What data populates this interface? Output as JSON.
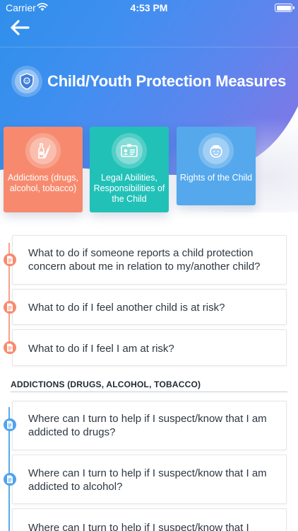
{
  "status_bar": {
    "carrier": "Carrier",
    "time": "4:53 PM"
  },
  "header": {
    "title": "Child/Youth Protection Measures"
  },
  "categories": [
    {
      "label": "Addictions (drugs, alcohol, tobacco)",
      "color": "#f78a6e",
      "icon": "bottle-cigarette-icon"
    },
    {
      "label": "Legal Abilities, Responsibilities of the Child",
      "color": "#22c1b8",
      "icon": "id-card-icon"
    },
    {
      "label": "Rights of the Child",
      "color": "#55a8ec",
      "icon": "child-face-icon"
    }
  ],
  "general_questions": [
    "What to do if someone reports a child protection concern about me in relation to my/another child?",
    "What to do if I feel another child is at risk?",
    "What to do if I feel I am at risk?"
  ],
  "sections": [
    {
      "title": "ADDICTIONS (DRUGS, ALCOHOL, TOBACCO)",
      "questions": [
        "Where can I turn to help if I suspect/know that I am addicted to drugs?",
        "Where can I turn to help if I suspect/know that I am addicted to alcohol?",
        "Where can I turn to help if I suspect/know that I"
      ]
    }
  ],
  "colors": {
    "accent_orange": "#f78a6e",
    "accent_teal": "#22c1b8",
    "accent_blue": "#55a8ec",
    "header_gradient_start": "#2f8fea",
    "header_gradient_end": "#8a72e0"
  }
}
